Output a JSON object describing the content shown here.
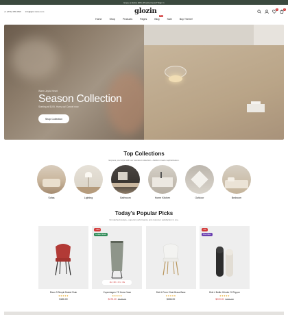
{
  "announcement": "Enjoy an Extra 20% off winter items? Sign In",
  "header": {
    "phone": "+1 (872) 435-3816",
    "email": "info@gfoz.store.com",
    "logo": "glozin",
    "cart_count": "0",
    "wishlist_count": "0"
  },
  "nav": {
    "items": [
      "Home",
      "Shop",
      "Products",
      "Pages",
      "Blog",
      "Sale",
      "Buy Theme!"
    ],
    "hot_label": "Hot"
  },
  "hero": {
    "subtitle": "Warm Joyful Heart",
    "title": "Season Collection",
    "description": "Starting at $105. Hurry up! Cancel now.",
    "button": "Shop Collection"
  },
  "collections": {
    "title": "Top Collections",
    "subtitle": "Express your style with our standout collection—fashion meets sophistication.",
    "items": [
      "Sofas",
      "Lighting",
      "Bathroom",
      "Home Kitchen",
      "Outdoor",
      "Bedroom"
    ]
  },
  "picks": {
    "title": "Today's Popular Picks",
    "subtitle": "Unmatched design—superior performance and customer satisfaction in one.",
    "products": [
      {
        "name": "Dixon 3 Simple Modal Chair",
        "stars": "★★★★★",
        "price": "$186.00",
        "old_price": "",
        "tag": "",
        "tag_color": ""
      },
      {
        "name": "Copenhagen YS Home Vase",
        "stars": "★★★★★",
        "price": "$175.20",
        "old_price": "$199.00",
        "tag": "-12%",
        "tag2": "Limited Stock",
        "tag_color": "#d23a3a",
        "timer": "13d : 08h : 47m : 38s"
      },
      {
        "name": "Dixit 4 Form Chair Brass Base",
        "stars": "★★★★★",
        "price": "$186.00",
        "old_price": "",
        "tag": "",
        "tag_color": ""
      },
      {
        "name": "Dixit 4 Bottle Grinder Of Pepper",
        "stars": "★★★★★",
        "price": "$219.00",
        "old_price": "$229.00",
        "tag": "-4%",
        "tag2": "Pre-Order",
        "tag_color": "#d23a3a"
      }
    ]
  },
  "colors": {
    "accent": "#3b4a3f",
    "sale": "#d23a3a",
    "limited": "#2e8b57",
    "preorder": "#6a3fb0"
  }
}
